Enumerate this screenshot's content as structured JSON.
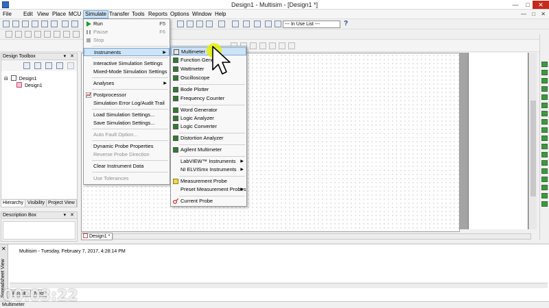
{
  "window": {
    "title": "Design1 - Multisim - [Design1 *]"
  },
  "menubar": {
    "items": [
      "File",
      "Edit",
      "View",
      "Place",
      "MCU",
      "Simulate",
      "Transfer",
      "Tools",
      "Reports",
      "Options",
      "Window",
      "Help"
    ],
    "active": "Simulate"
  },
  "toolbar": {
    "in_use_list": "--- In Use List ---"
  },
  "design_toolbox": {
    "title": "Design Toolbox",
    "tree": [
      "Design1",
      "Design1"
    ],
    "tabs": [
      "Hierarchy",
      "Visibility",
      "Project View"
    ]
  },
  "description_box": {
    "title": "Description Box"
  },
  "document_tab": "Design1 *",
  "simulate_menu": {
    "run": "Run",
    "run_key": "F5",
    "pause": "Pause",
    "pause_key": "F6",
    "stop": "Stop",
    "instruments": "Instruments",
    "interactive_settings": "Interactive Simulation Settings",
    "mixed_mode_settings": "Mixed-Mode Simulation Settings",
    "analyses": "Analyses",
    "postprocessor": "Postprocessor",
    "error_log": "Simulation Error Log/Audit Trail",
    "load_settings": "Load Simulation Settings...",
    "save_settings": "Save Simulation Settings...",
    "auto_fault": "Auto Fault Option...",
    "dynamic_probe": "Dynamic Probe Properties",
    "reverse_probe": "Reverse Probe Direction",
    "clear_instrument": "Clear Instrument Data",
    "use_tolerances": "Use Tolerances"
  },
  "instruments_menu": {
    "multimeter": "Multimeter",
    "function_generator": "Function Generator",
    "wattmeter": "Wattmeter",
    "oscilloscope": "Oscilloscope",
    "bode_plotter": "Bode Plotter",
    "frequency_counter": "Frequency Counter",
    "word_generator": "Word Generator",
    "logic_analyzer": "Logic Analyzer",
    "logic_converter": "Logic Converter",
    "distortion_analyzer": "Distortion Analyzer",
    "agilent_multimeter": "Agilent Multimeter",
    "labview": "LabVIEW™ Instruments",
    "ni_elvismx": "NI ELVISmx Instruments",
    "measurement_probe": "Measurement Probe",
    "preset_probes": "Preset Measurement Probes",
    "current_probe": "Current Probe"
  },
  "spreadsheet": {
    "side_label": "Spreadsheet View",
    "log_line": "Multisim  -  Tuesday, February 7, 2017, 4:28:14 PM",
    "tabs": [
      "Results",
      "Nets"
    ]
  },
  "statusbar": {
    "text": "Multimeter"
  },
  "overlay": {
    "timestamp": "00:03:22"
  }
}
